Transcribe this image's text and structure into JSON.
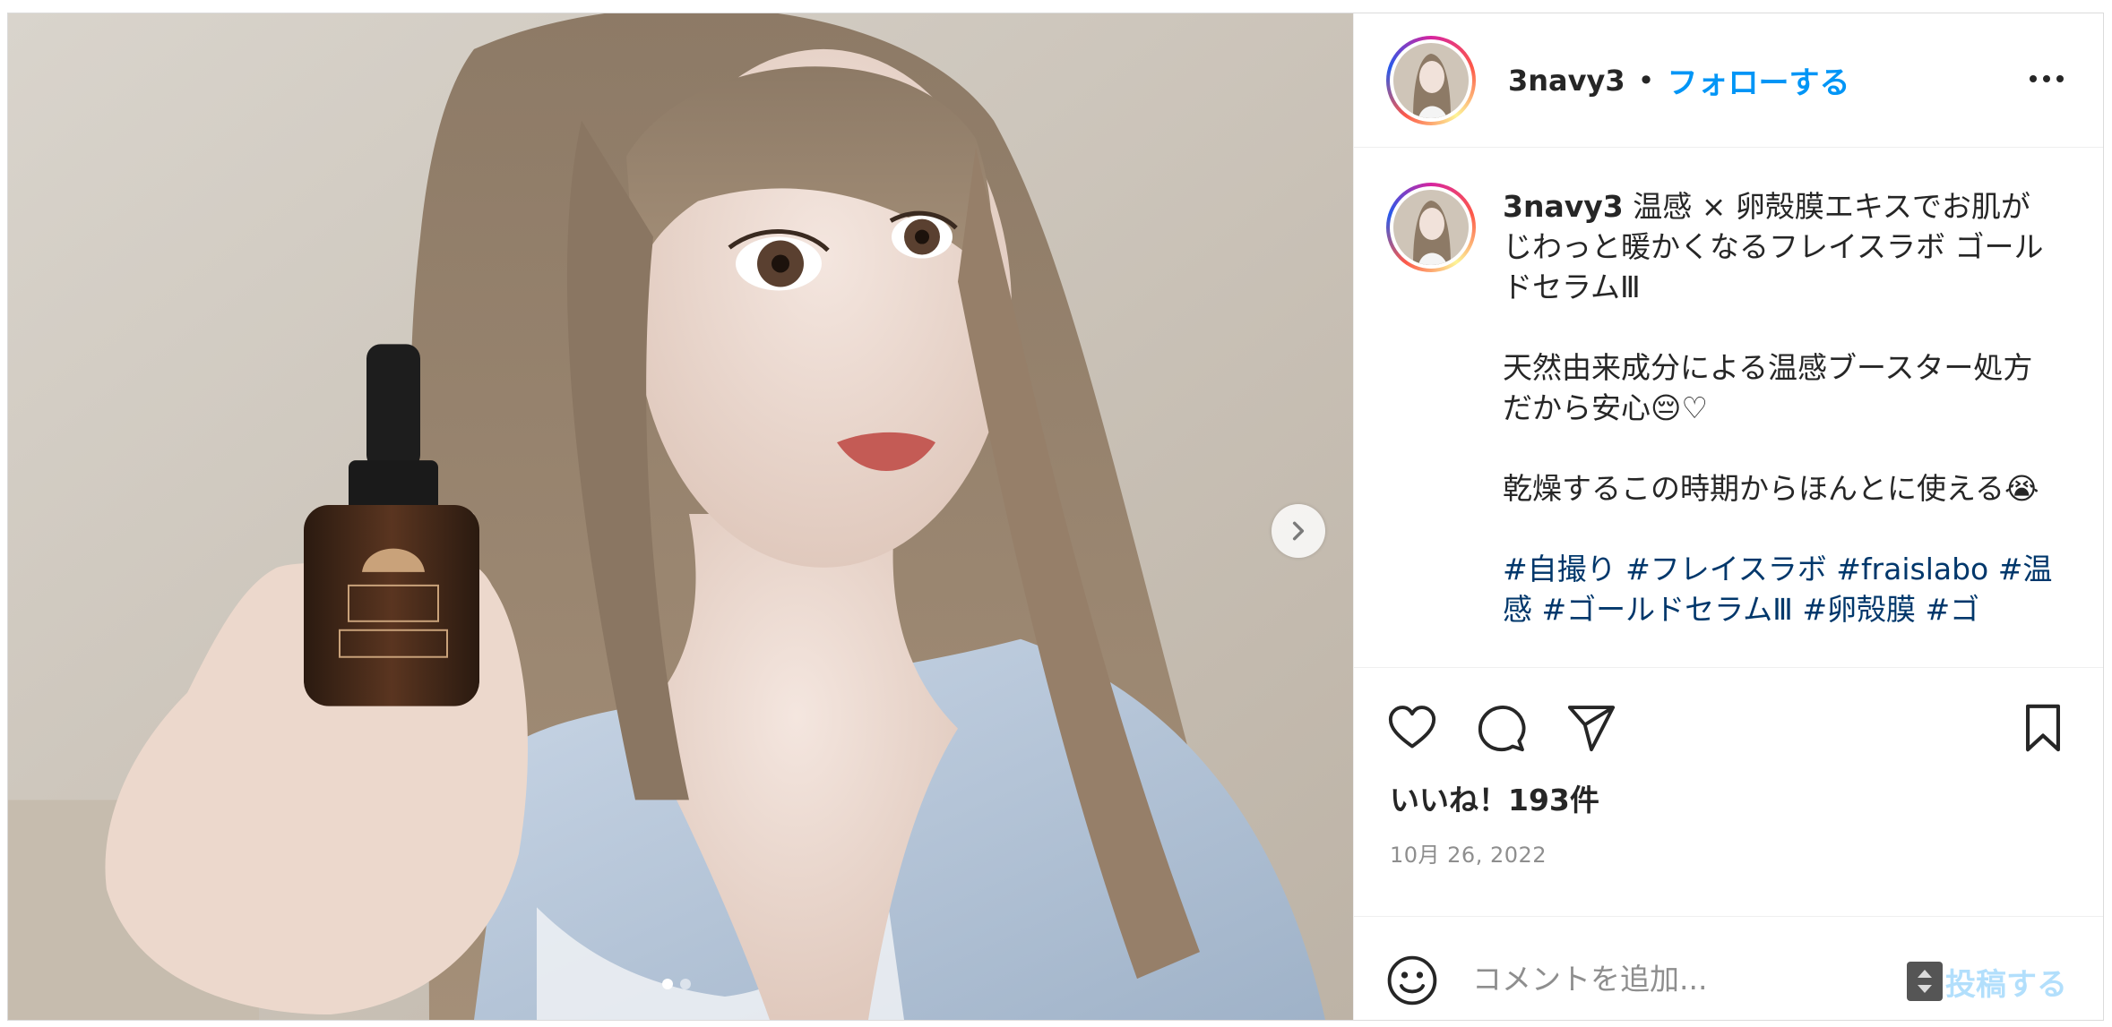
{
  "post": {
    "username": "3navy3",
    "separator": "•",
    "follow_label": "フォローする",
    "more_icon": "more-horizontal-icon"
  },
  "caption": {
    "username": "3navy3",
    "line1": "温感 × 卵殻膜エキスでお肌がじわっと暖かくなるフレイスラボ ゴールドセラムⅢ",
    "line2": "天然由来成分による温感ブースター処方だから安心😔♡",
    "line3": "乾燥するこの時期からほんとに使える😭",
    "hashtags": "#自撮り #フレイスラボ #fraislabo #温感 #ゴールドセラムⅢ #卵殻膜 #ゴ"
  },
  "actions": {
    "like_icon": "heart-icon",
    "comment_icon": "comment-icon",
    "share_icon": "send-icon",
    "save_icon": "bookmark-icon"
  },
  "likes_text": "いいね！193件",
  "date_text": "10月 26, 2022",
  "comment": {
    "emoji_icon": "smiley-icon",
    "placeholder": "コメントを追加...",
    "post_label": "投稿する"
  },
  "carousel": {
    "current": 1,
    "total": 2,
    "next_icon": "chevron-right-icon"
  },
  "colors": {
    "accent": "#0095f6",
    "post_disabled": "#b2dffc",
    "hashtag": "#00376b",
    "muted": "#8e8e8e"
  }
}
